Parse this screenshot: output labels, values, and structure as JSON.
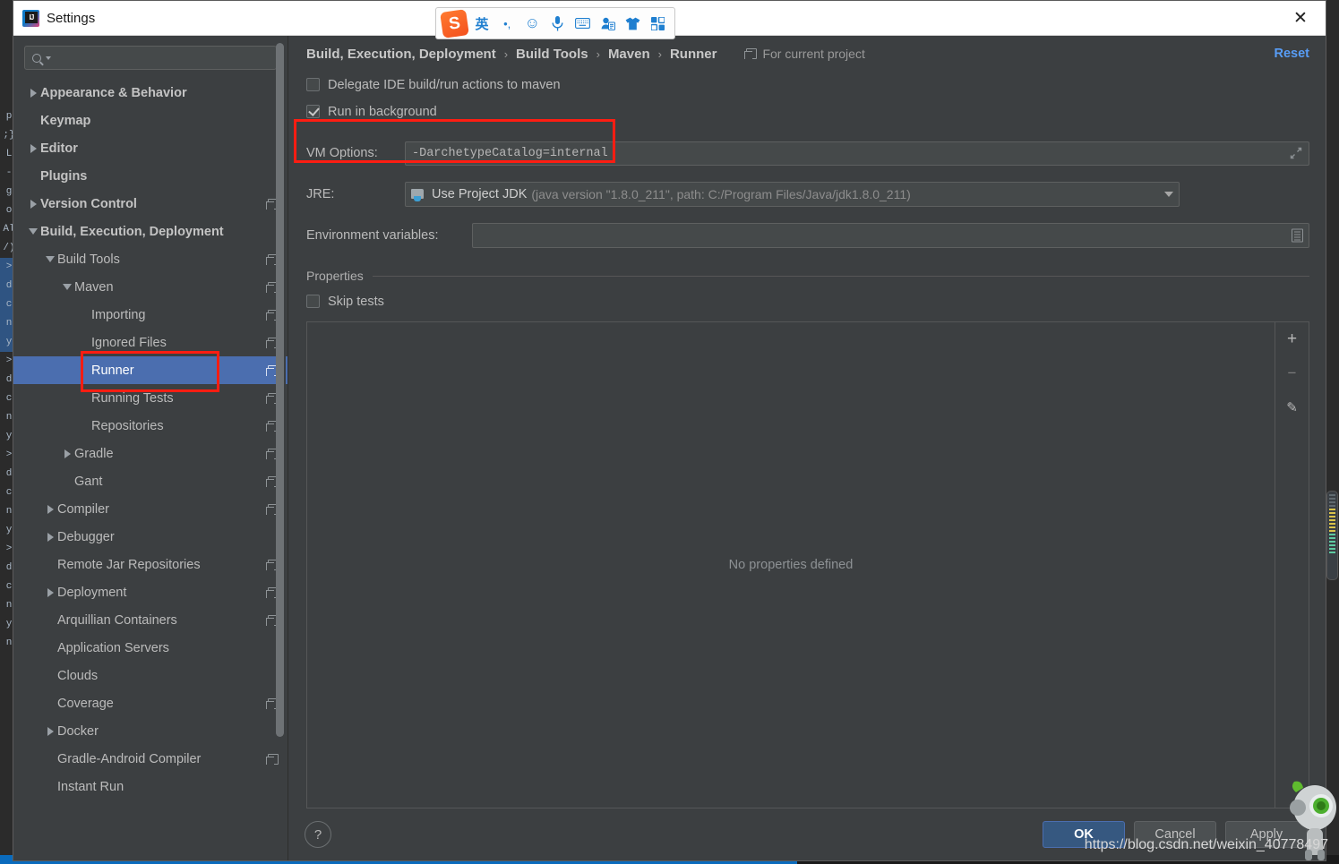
{
  "window": {
    "title": "Settings",
    "logo_icon": "intellij-idea-logo",
    "close_icon": "close-icon"
  },
  "ime_toolbar": {
    "items": [
      {
        "name": "sogou-logo-icon",
        "glyph": "S"
      },
      {
        "name": "language-mode-icon",
        "glyph": "英"
      },
      {
        "name": "punctuation-mode-icon",
        "glyph": "•,"
      },
      {
        "name": "emoji-icon",
        "glyph": "☺"
      },
      {
        "name": "voice-input-icon",
        "glyph": "🎤"
      },
      {
        "name": "soft-keyboard-icon",
        "glyph": "⌨"
      },
      {
        "name": "user-account-icon",
        "glyph": "👤"
      },
      {
        "name": "skin-icon",
        "glyph": "👕"
      },
      {
        "name": "toolbox-icon",
        "glyph": "⬚"
      }
    ]
  },
  "search": {
    "value": "",
    "placeholder": "",
    "icon": "search-icon"
  },
  "sidebar": {
    "items": [
      {
        "label": "Appearance & Behavior",
        "indent": 0,
        "twisty": "right",
        "bold": true,
        "copy": false,
        "selected": false
      },
      {
        "label": "Keymap",
        "indent": 0,
        "twisty": "none",
        "bold": true,
        "copy": false,
        "selected": false
      },
      {
        "label": "Editor",
        "indent": 0,
        "twisty": "right",
        "bold": true,
        "copy": false,
        "selected": false
      },
      {
        "label": "Plugins",
        "indent": 0,
        "twisty": "none",
        "bold": true,
        "copy": false,
        "selected": false
      },
      {
        "label": "Version Control",
        "indent": 0,
        "twisty": "right",
        "bold": true,
        "copy": true,
        "selected": false
      },
      {
        "label": "Build, Execution, Deployment",
        "indent": 0,
        "twisty": "down",
        "bold": true,
        "copy": false,
        "selected": false
      },
      {
        "label": "Build Tools",
        "indent": 1,
        "twisty": "down",
        "bold": false,
        "copy": true,
        "selected": false
      },
      {
        "label": "Maven",
        "indent": 2,
        "twisty": "down",
        "bold": false,
        "copy": true,
        "selected": false
      },
      {
        "label": "Importing",
        "indent": 3,
        "twisty": "none",
        "bold": false,
        "copy": true,
        "selected": false
      },
      {
        "label": "Ignored Files",
        "indent": 3,
        "twisty": "none",
        "bold": false,
        "copy": true,
        "selected": false
      },
      {
        "label": "Runner",
        "indent": 3,
        "twisty": "none",
        "bold": false,
        "copy": true,
        "selected": true
      },
      {
        "label": "Running Tests",
        "indent": 3,
        "twisty": "none",
        "bold": false,
        "copy": true,
        "selected": false
      },
      {
        "label": "Repositories",
        "indent": 3,
        "twisty": "none",
        "bold": false,
        "copy": true,
        "selected": false
      },
      {
        "label": "Gradle",
        "indent": 2,
        "twisty": "right",
        "bold": false,
        "copy": true,
        "selected": false
      },
      {
        "label": "Gant",
        "indent": 2,
        "twisty": "none",
        "bold": false,
        "copy": true,
        "selected": false
      },
      {
        "label": "Compiler",
        "indent": 1,
        "twisty": "right",
        "bold": false,
        "copy": true,
        "selected": false
      },
      {
        "label": "Debugger",
        "indent": 1,
        "twisty": "right",
        "bold": false,
        "copy": false,
        "selected": false
      },
      {
        "label": "Remote Jar Repositories",
        "indent": 1,
        "twisty": "none",
        "bold": false,
        "copy": true,
        "selected": false
      },
      {
        "label": "Deployment",
        "indent": 1,
        "twisty": "right",
        "bold": false,
        "copy": true,
        "selected": false
      },
      {
        "label": "Arquillian Containers",
        "indent": 1,
        "twisty": "none",
        "bold": false,
        "copy": true,
        "selected": false
      },
      {
        "label": "Application Servers",
        "indent": 1,
        "twisty": "none",
        "bold": false,
        "copy": false,
        "selected": false
      },
      {
        "label": "Clouds",
        "indent": 1,
        "twisty": "none",
        "bold": false,
        "copy": false,
        "selected": false
      },
      {
        "label": "Coverage",
        "indent": 1,
        "twisty": "none",
        "bold": false,
        "copy": true,
        "selected": false
      },
      {
        "label": "Docker",
        "indent": 1,
        "twisty": "right",
        "bold": false,
        "copy": false,
        "selected": false
      },
      {
        "label": "Gradle-Android Compiler",
        "indent": 1,
        "twisty": "none",
        "bold": false,
        "copy": true,
        "selected": false
      },
      {
        "label": "Instant Run",
        "indent": 1,
        "twisty": "none",
        "bold": false,
        "copy": false,
        "selected": false
      }
    ]
  },
  "breadcrumb": {
    "items": [
      "Build, Execution, Deployment",
      "Build Tools",
      "Maven",
      "Runner"
    ],
    "separator": "›",
    "scope_label": "For current project",
    "scope_icon": "project-scope-icon",
    "reset_label": "Reset"
  },
  "form": {
    "delegate_checkbox": {
      "label": "Delegate IDE build/run actions to maven",
      "checked": false
    },
    "run_background_checkbox": {
      "label": "Run in background",
      "checked": true
    },
    "vm_options": {
      "label": "VM Options:",
      "value": "-DarchetypeCatalog=internal",
      "expand_icon": "expand-icon"
    },
    "jre": {
      "label": "JRE:",
      "value": "Use Project JDK",
      "detail": "(java version \"1.8.0_211\", path: C:/Program Files/Java/jdk1.8.0_211)",
      "icon": "jdk-folder-icon",
      "arrow_icon": "chevron-down-icon"
    },
    "environment_variables": {
      "label": "Environment variables:",
      "value": "",
      "icon": "edit-list-icon"
    }
  },
  "properties": {
    "group_label": "Properties",
    "skip_tests_checkbox": {
      "label": "Skip tests",
      "checked": false
    },
    "empty_text": "No properties defined",
    "tools": [
      {
        "name": "add-property-button",
        "glyph": "+"
      },
      {
        "name": "remove-property-button",
        "glyph": "−"
      },
      {
        "name": "edit-property-button",
        "glyph": "✎"
      }
    ]
  },
  "footer": {
    "help_label": "?",
    "ok_label": "OK",
    "cancel_label": "Cancel",
    "apply_label": "Apply"
  },
  "watermark": {
    "text": "https://blog.csdn.net/weixin_40778497"
  },
  "colors": {
    "accent": "#4b6eaf",
    "link": "#589df6",
    "annotation": "#fd1d12",
    "panel_bg": "#3c3f41",
    "field_bg": "#45494a"
  },
  "background_editor": {
    "lines": [
      "p",
      ";}",
      "L",
      "-",
      "g",
      "o",
      "Al",
      "/)",
      ">",
      "d",
      "c",
      "n",
      "y",
      ">",
      "d",
      "c",
      "n",
      "y",
      ">",
      "d",
      "c",
      "n",
      "y",
      ">",
      "d",
      "c",
      "n",
      "y",
      "n"
    ]
  }
}
